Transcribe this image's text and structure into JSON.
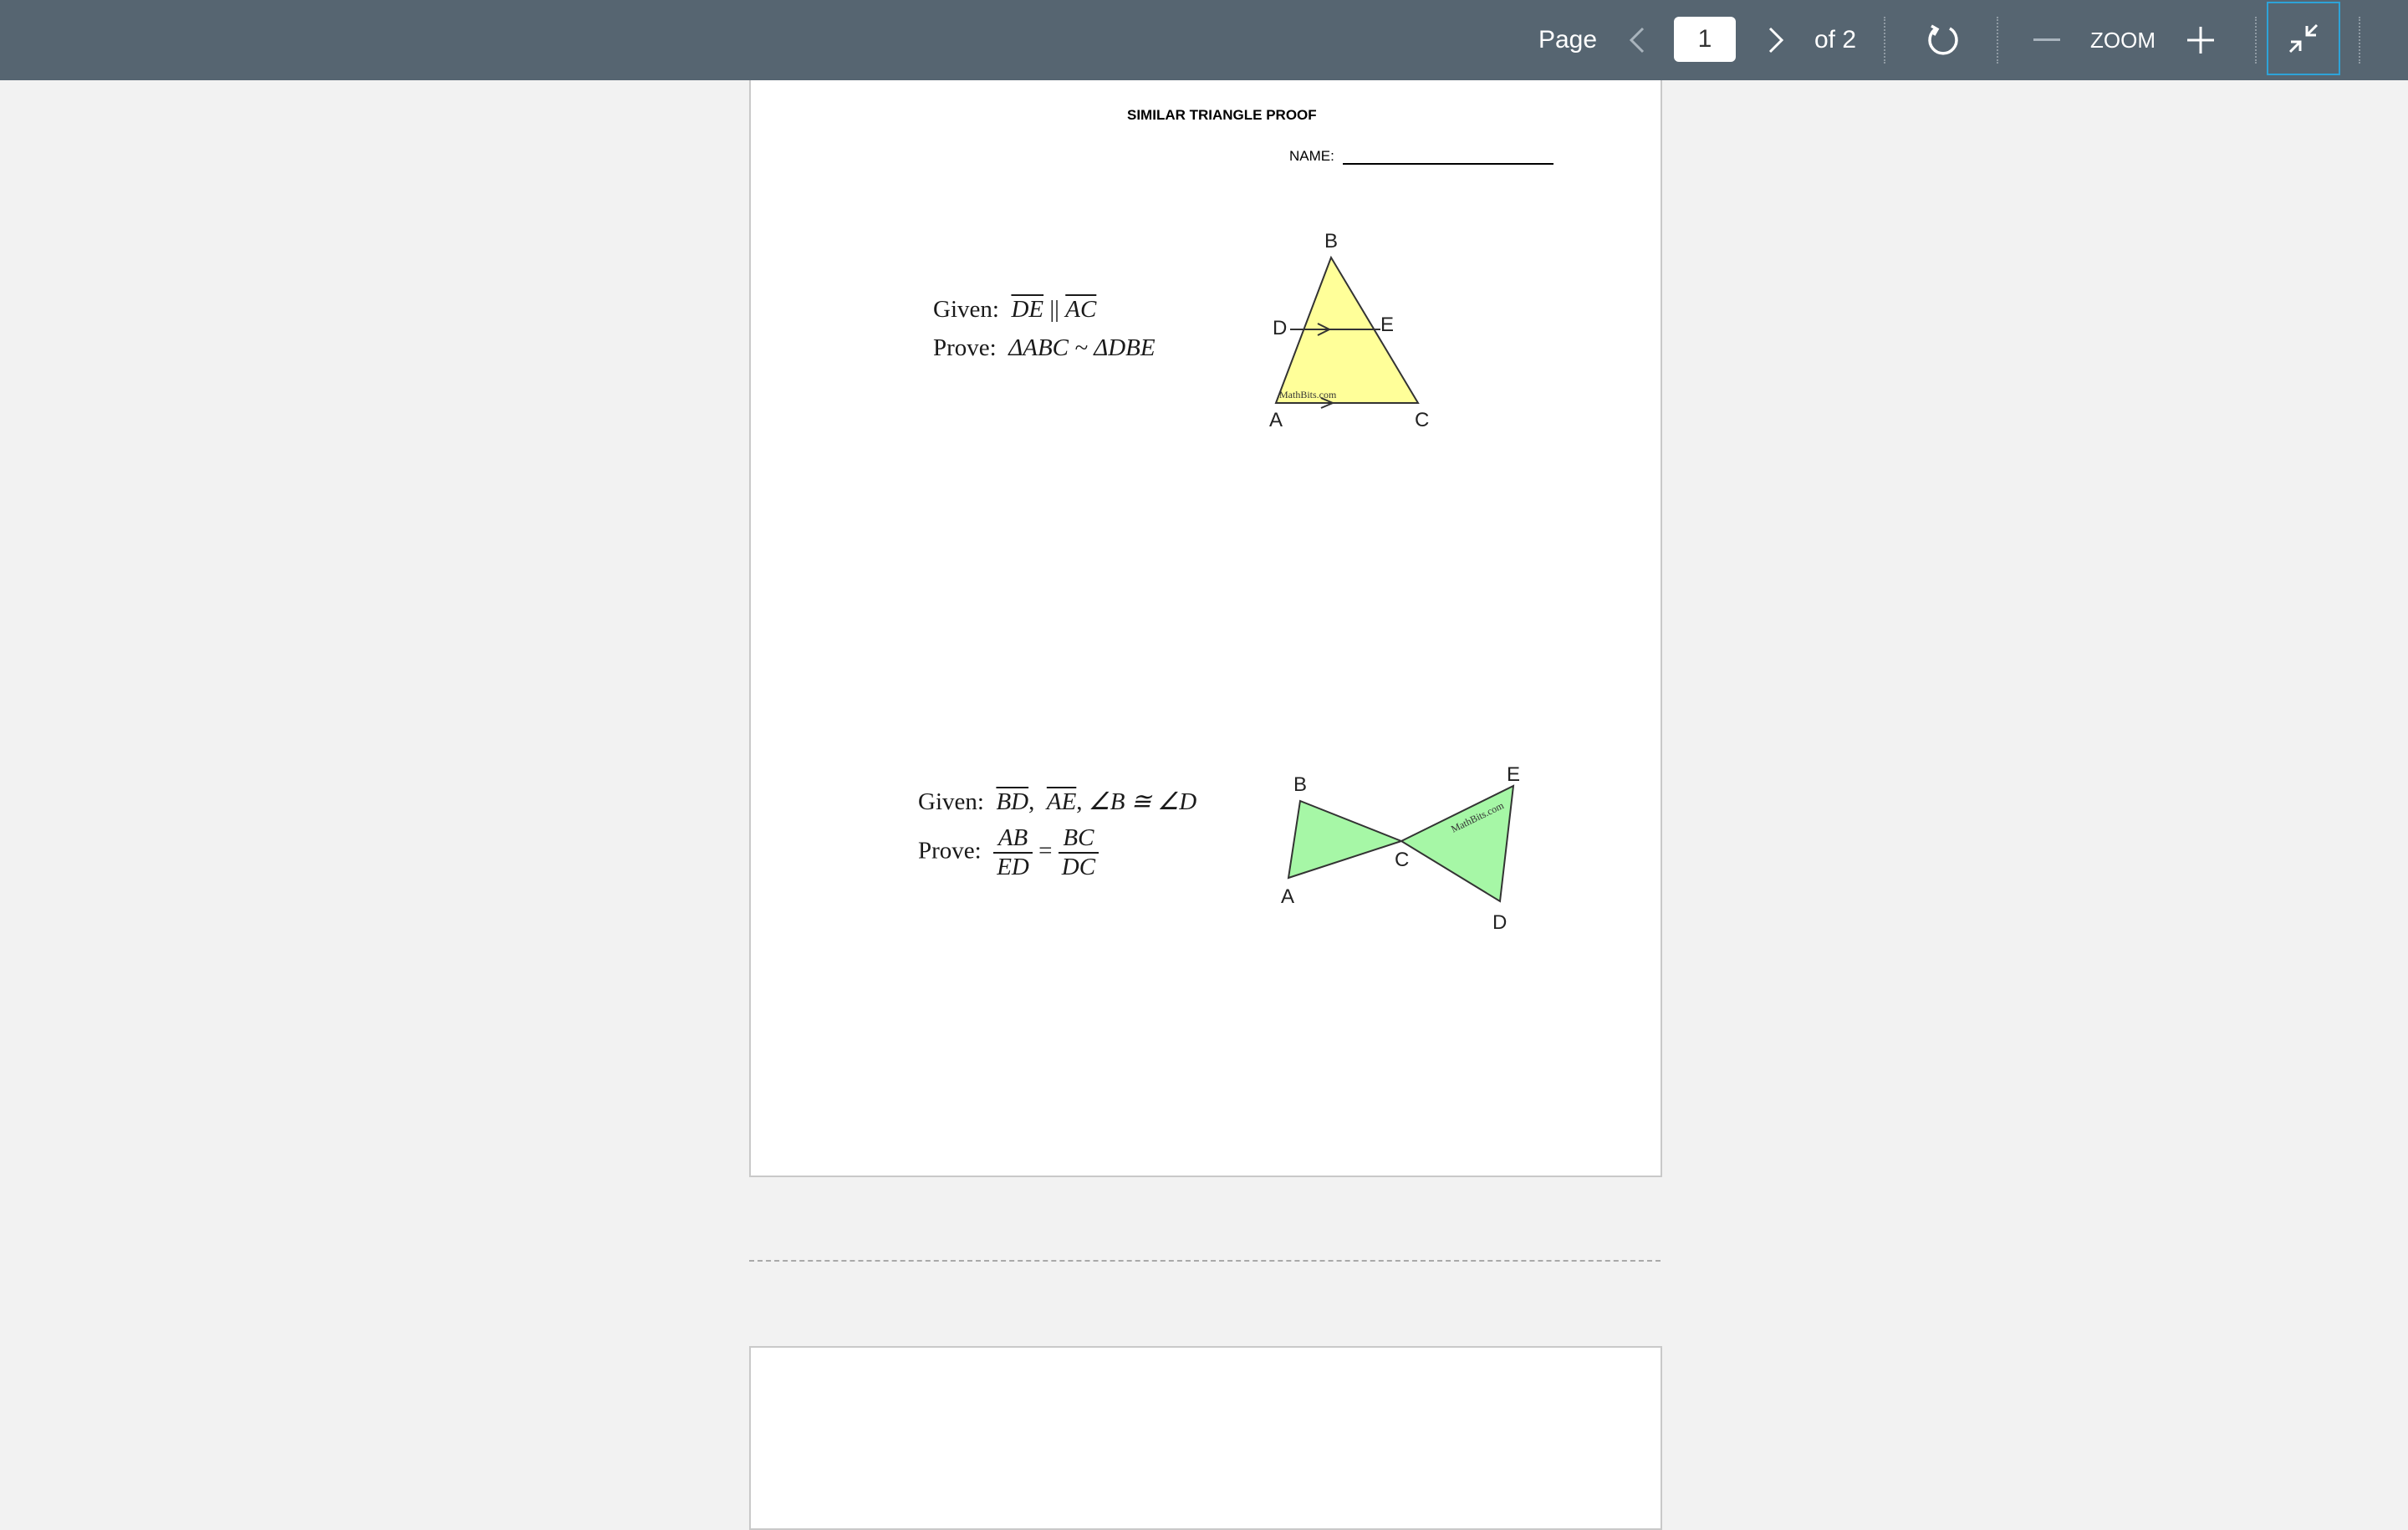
{
  "toolbar": {
    "page_label": "Page",
    "current_page": "1",
    "of_label": "of 2",
    "zoom_label": "ZOOM",
    "icons": [
      "chevron-left-icon",
      "chevron-right-icon",
      "rotate-icon",
      "minus-icon",
      "plus-icon",
      "exit-fullscreen-icon"
    ],
    "accent_color": "#2ea3d8",
    "background_color": "#566571"
  },
  "document": {
    "title": "SIMILAR TRIANGLE PROOF",
    "name_label": "NAME:",
    "problem1": {
      "given_label": "Given:",
      "seg1": "DE",
      "parallel": "||",
      "seg2": "AC",
      "prove_label": "Prove:",
      "prove_text": "ΔABC ~ ΔDBE",
      "figure": {
        "fill": "#ffff99",
        "labels": {
          "B": "B",
          "D": "D",
          "E": "E",
          "A": "A",
          "C": "C"
        },
        "watermark": "MathBits.com"
      }
    },
    "problem2": {
      "given_label": "Given:",
      "seg1": "BD",
      "seg2": "AE",
      "angles": "∠B ≅ ∠D",
      "prove_label": "Prove:",
      "frac1_num": "AB",
      "frac1_den": "ED",
      "equals": "=",
      "frac2_num": "BC",
      "frac2_den": "DC",
      "figure": {
        "fill": "#a6f7a6",
        "labels": {
          "B": "B",
          "E": "E",
          "C": "C",
          "A": "A",
          "D": "D"
        },
        "watermark": "MathBits.com"
      }
    }
  }
}
